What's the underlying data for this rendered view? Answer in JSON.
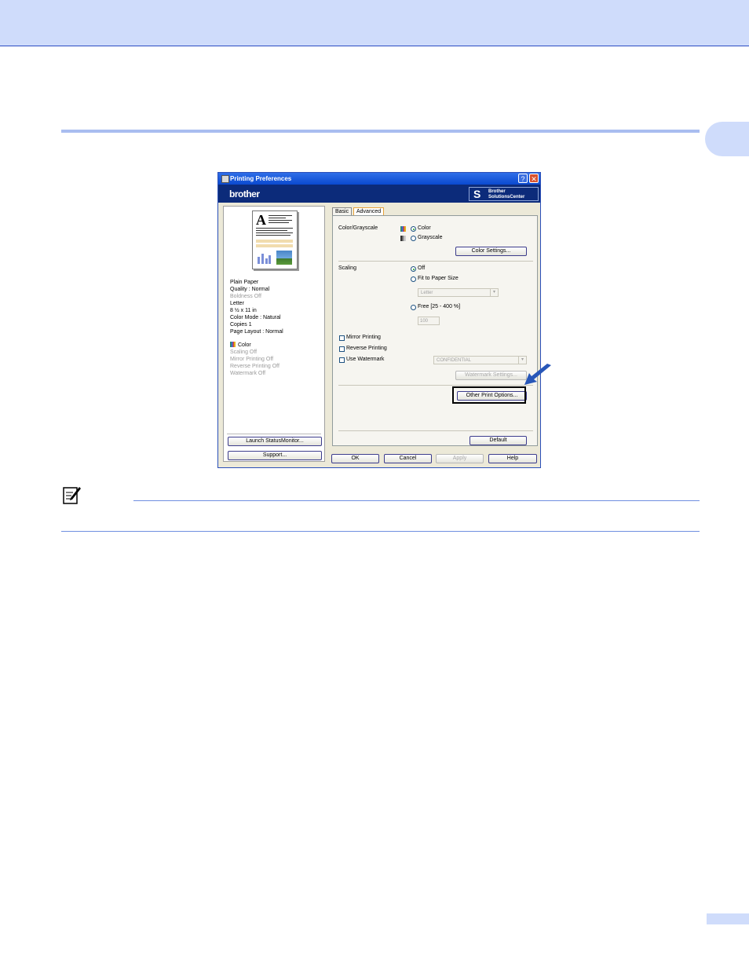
{
  "dialog": {
    "title": "Printing Preferences",
    "help_button": "?",
    "close_button": "✕",
    "brand": "brother",
    "solutions_center": [
      "Brother",
      "SolutionsCenter"
    ],
    "tabs": [
      {
        "label": "Basic",
        "active": false
      },
      {
        "label": "Advanced",
        "active": true
      }
    ],
    "summary": {
      "lines": [
        {
          "text": "Plain Paper",
          "enabled": true
        },
        {
          "text": "Quality : Normal",
          "enabled": true
        },
        {
          "text": "Boldness Off",
          "enabled": false
        },
        {
          "text": "Letter",
          "enabled": true
        },
        {
          "text": "8 ½ x 11 in",
          "enabled": true
        },
        {
          "text": "Color Mode : Natural",
          "enabled": true
        },
        {
          "text": "Copies 1",
          "enabled": true
        },
        {
          "text": "Page Layout : Normal",
          "enabled": true
        }
      ],
      "color_label": "Color",
      "status_lines": [
        "Scaling Off",
        "Mirror Printing Off",
        "Reverse Printing Off",
        "Watermark Off"
      ]
    },
    "left_buttons": {
      "launch_status_monitor": "Launch StatusMonitor...",
      "support": "Support..."
    },
    "advanced": {
      "color_grayscale_label": "Color/Grayscale",
      "color_option": "Color",
      "grayscale_option": "Grayscale",
      "color_settings_button": "Color Settings...",
      "scaling_label": "Scaling",
      "scaling_off": "Off",
      "fit_to_paper": "Fit to Paper Size",
      "paper_combo_value": "Letter",
      "free_option": "Free [25 - 400 %]",
      "free_value": "100",
      "mirror_printing": "Mirror Printing",
      "reverse_printing": "Reverse Printing",
      "use_watermark": "Use Watermark",
      "watermark_combo_value": "CONFIDENTIAL",
      "watermark_settings_button": "Watermark Settings...",
      "other_print_options_button": "Other Print Options...",
      "default_button": "Default"
    },
    "footer_buttons": {
      "ok": "OK",
      "cancel": "Cancel",
      "apply": "Apply",
      "help": "Help"
    }
  }
}
